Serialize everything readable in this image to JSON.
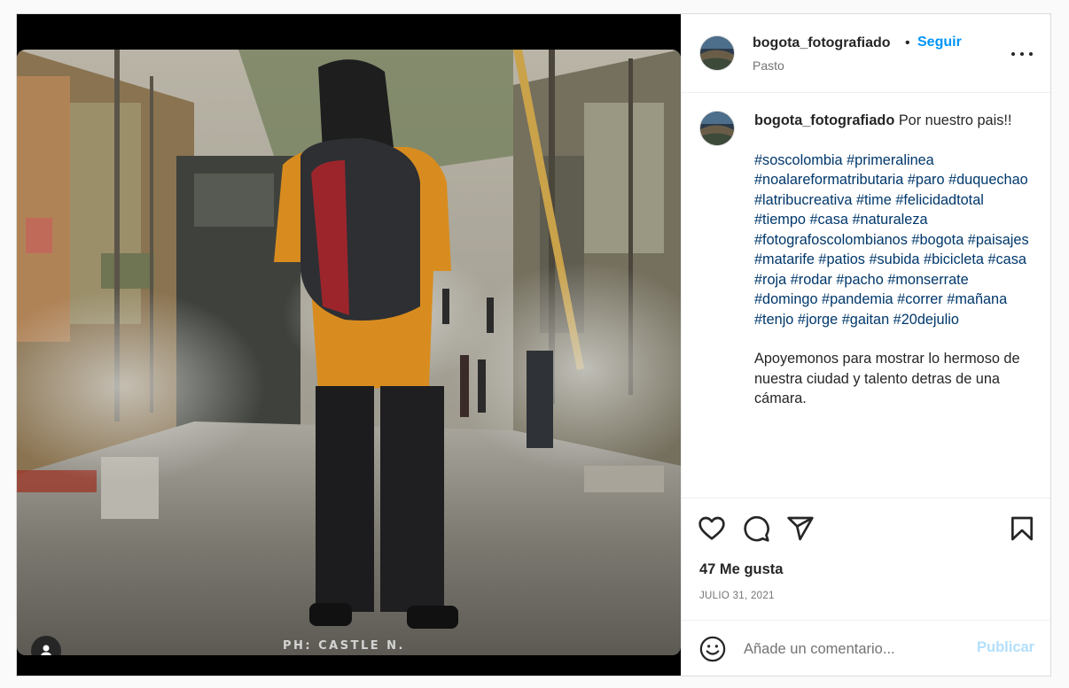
{
  "post": {
    "photo": {
      "alt": "",
      "watermark": "PH: CASTLE N."
    },
    "header": {
      "username": "bogota_fotografiado",
      "separator": "•",
      "follow_label": "Seguir",
      "location": "Pasto"
    },
    "caption": {
      "username": "bogota_fotografiado",
      "text": "Por nuestro pais!!",
      "hashtags": [
        "#soscolombia",
        "#primeralinea",
        "#noalareformatributaria",
        "#paro",
        "#duquechao",
        "#latribucreativa",
        "#time",
        "#felicidadtotal",
        "#tiempo",
        "#casa",
        "#naturaleza",
        "#fotografoscolombianos",
        "#bogota",
        "#paisajes",
        "#matarife",
        "#patios",
        "#subida",
        "#bicicleta",
        "#casa",
        "#roja",
        "#rodar",
        "#pacho",
        "#monserrate",
        "#domingo",
        "#pandemia",
        "#correr",
        "#mañana",
        "#tenjo",
        "#jorge",
        "#gaitan",
        "#20dejulio"
      ],
      "extra": "Apoyemonos para mostrar lo hermoso de nuestra ciudad y talento detras de una cámara."
    },
    "actions": {
      "likes": "47 Me gusta",
      "date": "JULIO 31, 2021"
    },
    "comment": {
      "placeholder": "Añade un comentario...",
      "publish_label": "Publicar"
    }
  },
  "colors": {
    "link_blue": "#0095f6",
    "hashtag": "#00376b",
    "publish_disabled": "#b2dffc"
  }
}
